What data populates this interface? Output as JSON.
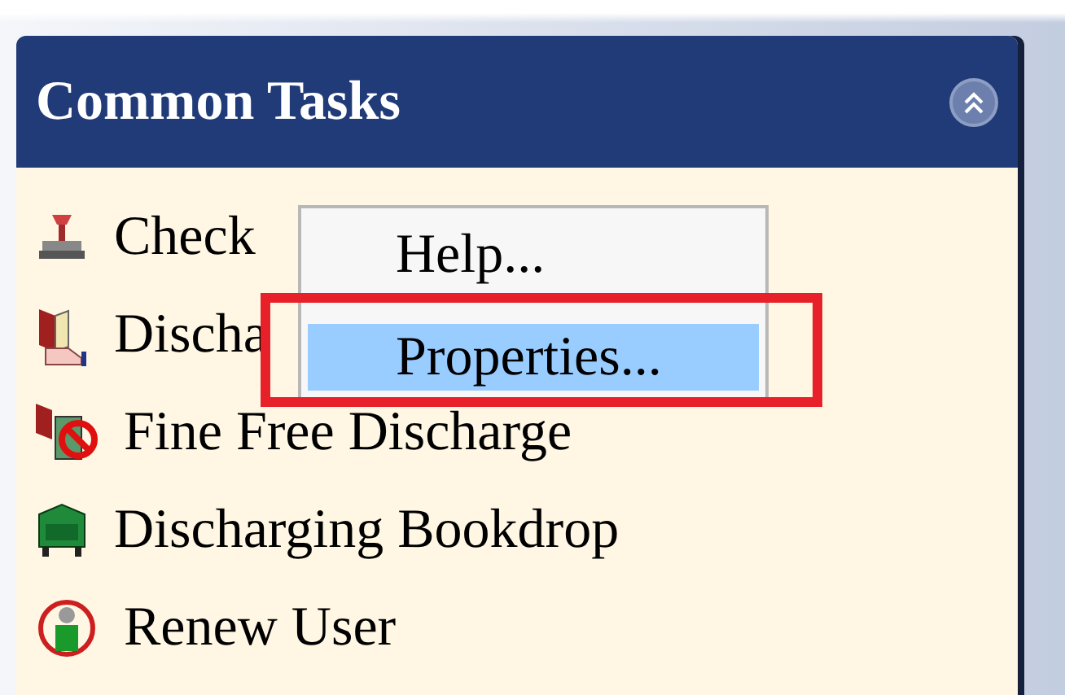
{
  "panel": {
    "title": "Common Tasks",
    "expanded": true
  },
  "tasks": [
    {
      "label": "Check"
    },
    {
      "label": "Discha"
    },
    {
      "label": "Fine Free Discharge"
    },
    {
      "label": "Discharging Bookdrop"
    },
    {
      "label": "Renew User"
    }
  ],
  "context_menu": [
    {
      "label": "Help...",
      "selected": false
    },
    {
      "label": "Properties...",
      "selected": true
    }
  ]
}
